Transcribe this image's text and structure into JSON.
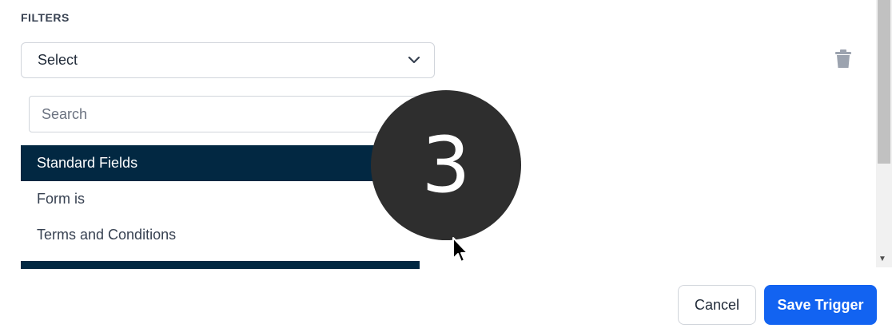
{
  "filters": {
    "title": "FILTERS",
    "select_value": "Select",
    "search_placeholder": "Search",
    "group_label": "Standard Fields",
    "options": [
      "Form is",
      "Terms and Conditions"
    ]
  },
  "overlay": {
    "step_number": "3"
  },
  "footer": {
    "cancel_label": "Cancel",
    "save_label": "Save Trigger"
  },
  "icons": {
    "select_chevron": "chevron-down-icon",
    "delete": "trash-icon",
    "pointer": "cursor-icon"
  },
  "colors": {
    "group_header_bg": "#022842",
    "primary_button": "#1263f1",
    "badge_bg": "#2e2e2e"
  }
}
